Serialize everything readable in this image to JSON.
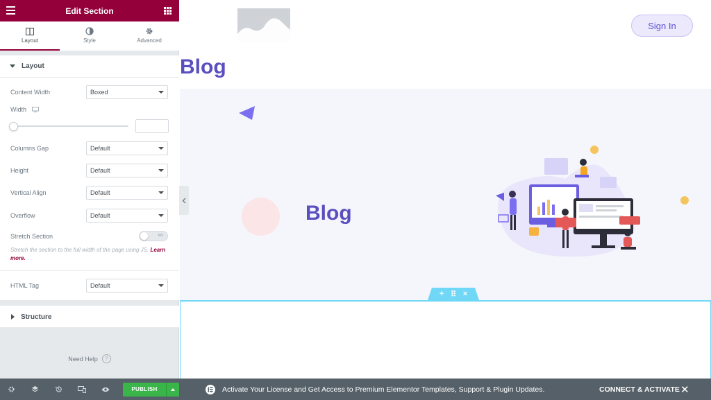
{
  "panel": {
    "title": "Edit Section",
    "tabs": [
      {
        "label": "Layout",
        "icon": "columns-icon",
        "active": true
      },
      {
        "label": "Style",
        "icon": "contrast-icon",
        "active": false
      },
      {
        "label": "Advanced",
        "icon": "gear-icon",
        "active": false
      }
    ],
    "layout_section": {
      "title": "Layout",
      "content_width": {
        "label": "Content Width",
        "value": "Boxed"
      },
      "width": {
        "label": "Width",
        "value": ""
      },
      "columns_gap": {
        "label": "Columns Gap",
        "value": "Default"
      },
      "height": {
        "label": "Height",
        "value": "Default"
      },
      "vertical_align": {
        "label": "Vertical Align",
        "value": "Default"
      },
      "overflow": {
        "label": "Overflow",
        "value": "Default"
      },
      "stretch": {
        "label": "Stretch Section",
        "toggle_text": "NO",
        "enabled": false,
        "description": "Stretch the section to the full width of the page using JS.",
        "learn_more": "Learn more."
      },
      "html_tag": {
        "label": "HTML Tag",
        "value": "Default"
      }
    },
    "structure_section": {
      "title": "Structure"
    },
    "help": "Need Help",
    "footer": {
      "publish": "PUBLISH"
    }
  },
  "preview": {
    "signin": "Sign In",
    "page_title": "Blog",
    "hero_title": "Blog",
    "section_handle": {
      "add": "+",
      "move": "⠿",
      "close": "×"
    }
  },
  "notice": {
    "message": "Activate Your License and Get Access to Premium Elementor Templates, Support & Plugin Updates.",
    "connect": "CONNECT & ACTIVATE",
    "close": "✕"
  },
  "colors": {
    "brand": "#93003a",
    "publish": "#39b54a",
    "accent_text": "#5a4fbf",
    "section_outline": "#71d7f7",
    "footer_bg": "#556068"
  }
}
